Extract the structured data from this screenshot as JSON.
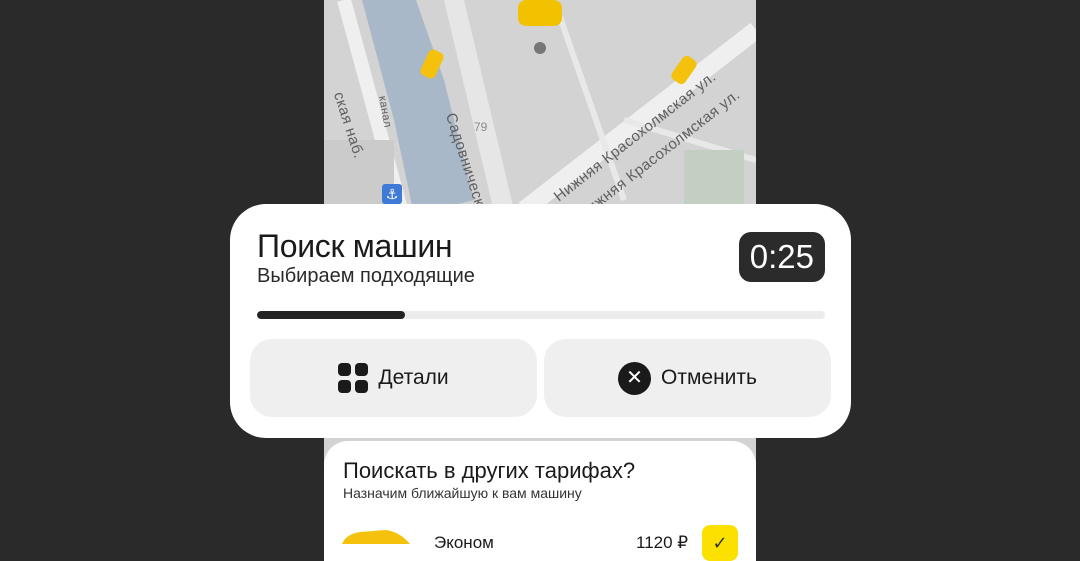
{
  "map": {
    "streets": [
      "Садовническая",
      "Нижняя Красохолмская ул.",
      "Нижняя Красохолмская ул.",
      "ская наб.",
      "канал"
    ],
    "house_number": "79",
    "anchor_icon": "anchor-icon"
  },
  "search_card": {
    "title": "Поиск машин",
    "subtitle": "Выбираем подходящие",
    "timer": "0:25",
    "progress": 0.26,
    "details_label": "Детали",
    "cancel_label": "Отменить",
    "details_icon": "grid-icon",
    "cancel_icon": "close-icon"
  },
  "tariffs_sheet": {
    "title": "Поискать в других тарифах?",
    "subtitle": "Назначим ближайшую к вам машину",
    "tariff_name": "Эконом",
    "tariff_price": "1120 ₽"
  },
  "colors": {
    "background": "#2a2a2a",
    "accent_yellow": "#fce000",
    "timer_bg": "#2b2b2b"
  }
}
